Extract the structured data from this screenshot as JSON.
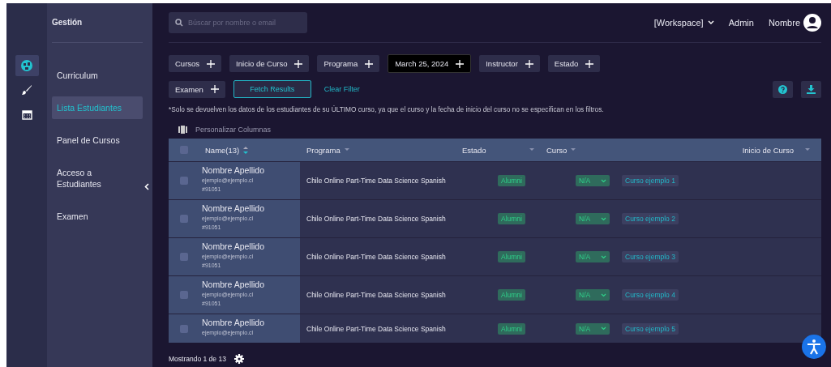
{
  "sidebar": {
    "icons": [
      {
        "kind": "globe",
        "selected": true
      },
      {
        "kind": "brush",
        "selected": false
      },
      {
        "kind": "calendar",
        "selected": false
      }
    ]
  },
  "nav": {
    "title": "Gestión",
    "items": [
      {
        "label": "Curriculum",
        "selected": false
      },
      {
        "label": "Lista Estudiantes",
        "selected": true
      },
      {
        "label": "Panel de Cursos",
        "selected": false
      },
      {
        "label": "Acceso a Estudiantes",
        "selected": false
      },
      {
        "label": "Examen",
        "selected": false
      }
    ]
  },
  "header": {
    "search": {
      "placeholder": "Búscar por nombre o email"
    },
    "workspace": "[Workspace]",
    "role": "Admin",
    "user": "Nombre"
  },
  "filters": [
    {
      "label": "Cursos",
      "active": false
    },
    {
      "label": "Inicio de Curso",
      "active": false
    },
    {
      "label": "Programa",
      "active": false
    },
    {
      "label": "March 25, 2024",
      "active": true
    },
    {
      "label": "Instructor",
      "active": false
    },
    {
      "label": "Estado",
      "active": false
    },
    {
      "label": "Examen",
      "active": false
    }
  ],
  "actions": {
    "fetch": "Fetch Results",
    "clear": "Clear Filter"
  },
  "note": "*Solo se devuelven los datos de los estudiantes de su ÚLTIMO curso, ya que el curso y la fecha de inicio del curso no se especifican en los filtros.",
  "customize": "Personalizar Columnas",
  "table": {
    "header_checked": false,
    "columns": [
      {
        "label": "Name(13)",
        "kind": "sort"
      },
      {
        "label": "Programa",
        "kind": "filter"
      },
      {
        "label": "Estado",
        "kind": "filter"
      },
      {
        "label": "Curso",
        "kind": "filter"
      },
      {
        "label": "Inicio de Curso",
        "kind": "filter"
      }
    ],
    "rows": [
      {
        "checked": false,
        "name": "Nombre Apellido",
        "email": "ejemplo@ejemplo.cl",
        "id": "#91051",
        "programa": "Chile Online Part-Time Data Science Spanish",
        "estado": "Alumni",
        "curso_select": "N/A",
        "curso": "Curso ejemplo 1"
      },
      {
        "checked": false,
        "name": "Nombre Apellido",
        "email": "ejemplo@ejemplo.cl",
        "id": "#91051",
        "programa": "Chile Online Part-Time Data Science Spanish",
        "estado": "Alumni",
        "curso_select": "N/A",
        "curso": "Curso ejemplo 2"
      },
      {
        "checked": false,
        "name": "Nombre Apellido",
        "email": "ejemplo@ejemplo.cl",
        "id": "#91051",
        "programa": "Chile Online Part-Time Data Science Spanish",
        "estado": "Alumni",
        "curso_select": "N/A",
        "curso": "Curso ejemplo 3"
      },
      {
        "checked": false,
        "name": "Nombre Apellido",
        "email": "ejemplo@ejemplo.cl",
        "id": "#91051",
        "programa": "Chile Online Part-Time Data Science Spanish",
        "estado": "Alumni",
        "curso_select": "N/A",
        "curso": "Curso ejemplo 4"
      },
      {
        "checked": false,
        "name": "Nombre Apellido",
        "email": "ejemplo@ejemplo.cl",
        "programa": "Chile Online Part-Time Data Science Spanish",
        "estado": "Alumni",
        "curso_select": "N/A",
        "curso": "Curso ejemplo 5"
      }
    ]
  },
  "footer": {
    "showing": "Mostrando 1 de 13"
  }
}
